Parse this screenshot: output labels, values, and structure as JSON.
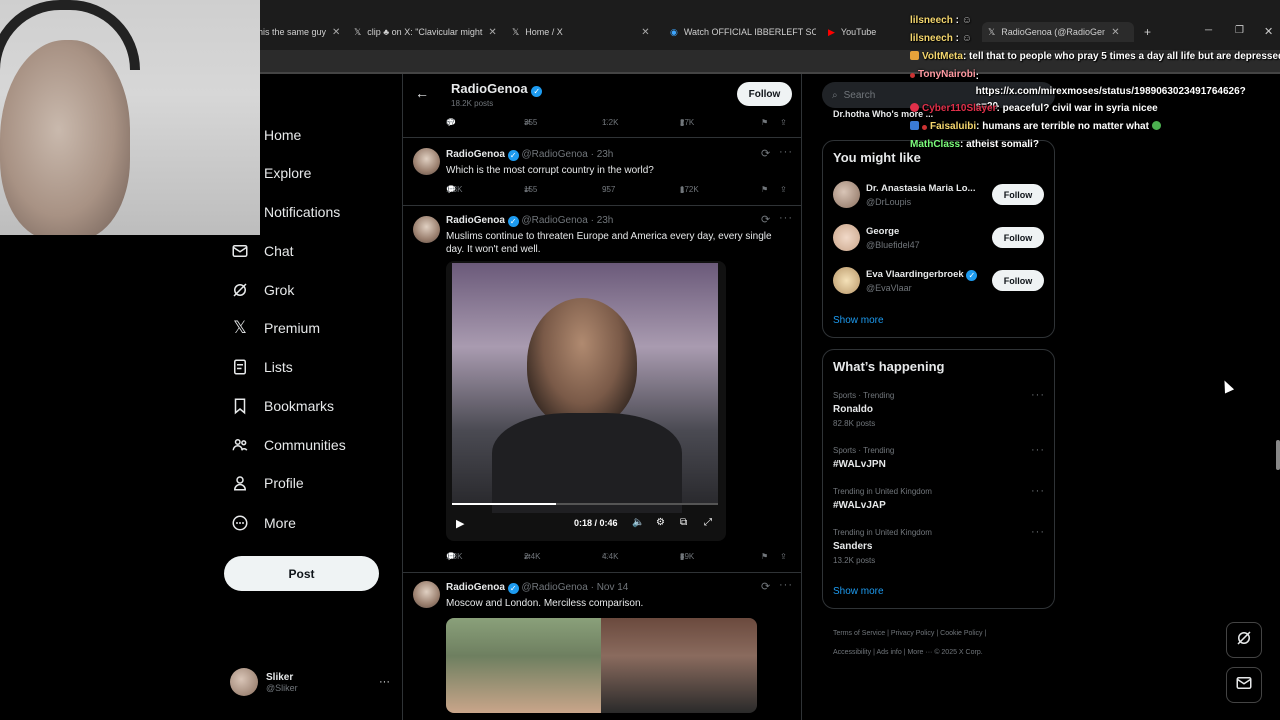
{
  "browser": {
    "tabs": [
      {
        "label": "his the same guy"
      },
      {
        "label": "clip ♣ on X: \"Clavicular might"
      },
      {
        "label": "Home / X"
      },
      {
        "label": "Watch OFFICIAL IBBERLEFT SO"
      },
      {
        "label": "YouTube"
      },
      {
        "label": "RadioGenoa (@RadioGenoa) /"
      }
    ]
  },
  "sidebar": {
    "items": [
      {
        "label": "Home",
        "icon": "home-icon"
      },
      {
        "label": "Explore",
        "icon": "search-icon"
      },
      {
        "label": "Notifications",
        "icon": "bell-icon"
      },
      {
        "label": "Chat",
        "icon": "mail-icon"
      },
      {
        "label": "Grok",
        "icon": "grok-icon"
      },
      {
        "label": "Premium",
        "icon": "x-logo-icon"
      },
      {
        "label": "Lists",
        "icon": "list-icon"
      },
      {
        "label": "Bookmarks",
        "icon": "bookmark-icon"
      },
      {
        "label": "Communities",
        "icon": "communities-icon"
      },
      {
        "label": "Profile",
        "icon": "person-icon"
      },
      {
        "label": "More",
        "icon": "more-circle-icon"
      }
    ],
    "post_label": "Post",
    "account": {
      "name": "Sliker",
      "handle": "@Sliker"
    }
  },
  "profile_header": {
    "name": "RadioGenoa",
    "posts": "18.2K posts",
    "follow_label": "Follow"
  },
  "tweets": [
    {
      "replies": "67",
      "reposts": "355",
      "likes": "1.2K",
      "views": "27K"
    },
    {
      "name": "RadioGenoa",
      "handle": "@RadioGenoa",
      "time": "23h",
      "text": "Which is the most corrupt country in the world?",
      "replies": "1.3K",
      "reposts": "155",
      "likes": "957",
      "views": "172K"
    },
    {
      "name": "RadioGenoa",
      "handle": "@RadioGenoa",
      "time": "23h",
      "text": "Muslims continue to threaten Europe and America every day, every single day. It won't end well.",
      "video_time": "0:18 / 0:46",
      "replies": "1.8K",
      "reposts": "2.4K",
      "likes": "4.4K",
      "views": "89K"
    },
    {
      "name": "RadioGenoa",
      "handle": "@RadioGenoa",
      "time": "Nov 14",
      "text": "Moscow and London. Merciless comparison."
    }
  ],
  "right": {
    "search_placeholder": "Search",
    "scrolled_text": "Dr.hotha Who's more ...",
    "you_might_like": {
      "title": "You might like",
      "users": [
        {
          "name": "Dr. Anastasia Maria Lo...",
          "handle": "@DrLoupis",
          "follow": "Follow"
        },
        {
          "name": "George",
          "handle": "@Bluefidel47",
          "follow": "Follow"
        },
        {
          "name": "Eva Vlaardingerbroek",
          "handle": "@EvaVlaar",
          "follow": "Follow"
        }
      ],
      "show_more": "Show more"
    },
    "whats_happening": {
      "title": "What’s happening",
      "trends": [
        {
          "category": "Sports · Trending",
          "name": "Ronaldo",
          "posts": "82.8K posts"
        },
        {
          "category": "Sports · Trending",
          "name": "#WALvJPN",
          "posts": ""
        },
        {
          "category": "Trending in United Kingdom",
          "name": "#WALvJAP",
          "posts": ""
        },
        {
          "category": "Trending in United Kingdom",
          "name": "Sanders",
          "posts": "13.2K posts"
        }
      ],
      "show_more": "Show more"
    },
    "footer": {
      "row1": [
        "Terms of Service",
        "Privacy Policy",
        "Cookie Policy"
      ],
      "row2": [
        "Accessibility",
        "Ads info",
        "More ···",
        "© 2025 X Corp."
      ]
    }
  },
  "chat": [
    {
      "user": "lilsneech",
      "msg": "",
      "color": "#f5d76e"
    },
    {
      "user": "lilsneech",
      "msg": "",
      "color": "#f5d76e"
    },
    {
      "user": "VoltMeta",
      "msg": ": tell that to people who pray 5 times a day all life but are depressed",
      "color": "#f5d76e"
    },
    {
      "user": "TonyNairobi",
      "msg": ": https://x.com/mirexmoses/status/1989063023491764626?s=20",
      "color": "#ff9aa2"
    },
    {
      "user": "Cyber110Slayer",
      "msg": ": peaceful? civil war in syria nicee",
      "color": "#e0304a"
    },
    {
      "user": "Faisaluibi",
      "msg": ": humans are terrible no matter what",
      "color": "#f5d76e"
    },
    {
      "user": "MathClass",
      "msg": ": atheist somali?",
      "color": "#7cfc7c"
    }
  ],
  "colors": {
    "accent": "#1d9bf0",
    "background": "#000000",
    "border": "#2f3336",
    "muted": "#71767b"
  }
}
